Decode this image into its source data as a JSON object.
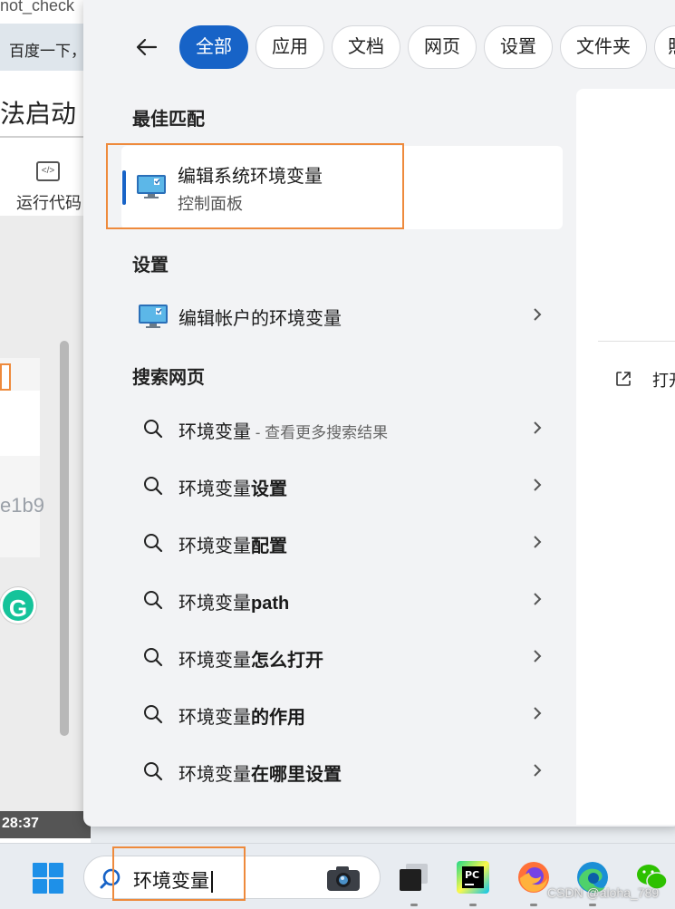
{
  "background_window": {
    "tab_text": "not_check",
    "address_text": "百度一下，",
    "heading": "法启动",
    "run_code_label": "运行代码",
    "run_code_icon": "code-icon",
    "card_text": "e1b9",
    "clock": "28:37"
  },
  "search_flyout": {
    "filters": [
      "全部",
      "应用",
      "文档",
      "网页",
      "设置",
      "文件夹",
      "照"
    ],
    "active_filter_index": 0,
    "best_match": {
      "section_title": "最佳匹配",
      "title": "编辑系统环境变量",
      "subtitle": "控制面板",
      "icon": "monitor-icon"
    },
    "settings": {
      "section_title": "设置",
      "items": [
        {
          "label": "编辑帐户的环境变量",
          "icon": "monitor-icon"
        }
      ]
    },
    "web": {
      "section_title": "搜索网页",
      "items": [
        {
          "prefix": "环境变量",
          "bold": "",
          "hint": " - 查看更多搜索结果"
        },
        {
          "prefix": "环境变量",
          "bold": "设置",
          "hint": ""
        },
        {
          "prefix": "环境变量",
          "bold": "配置",
          "hint": ""
        },
        {
          "prefix": "环境变量",
          "bold": "path",
          "hint": ""
        },
        {
          "prefix": "环境变量",
          "bold": "怎么打开",
          "hint": ""
        },
        {
          "prefix": "环境变量",
          "bold": "的作用",
          "hint": ""
        },
        {
          "prefix": "环境变量",
          "bold": "在哪里设置",
          "hint": ""
        }
      ]
    },
    "preview": {
      "open_label": "打开",
      "open_icon": "open-external-icon"
    }
  },
  "taskbar": {
    "search_value": "环境变量",
    "apps": [
      "windows-start-icon",
      "search-icon",
      "camera-icon",
      "task-view-icon",
      "pycharm-icon",
      "firefox-icon",
      "edge-icon",
      "wechat-icon"
    ],
    "pycharm_label": "PC"
  },
  "watermark": "CSDN @aloha_789",
  "colors": {
    "accent": "#1763c7",
    "highlight": "#ee8a3c"
  }
}
